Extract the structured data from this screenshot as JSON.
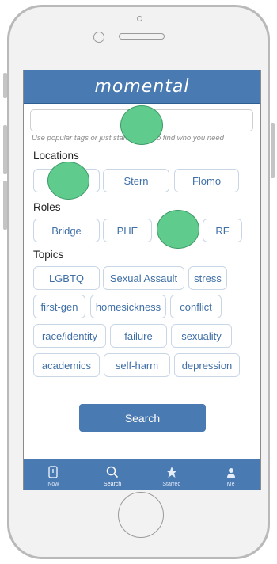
{
  "app": {
    "title": "momental"
  },
  "search": {
    "value": "",
    "hint": "Use popular tags or just start to type to find who you need"
  },
  "locations": {
    "label": "Locations",
    "chips": [
      "Stern",
      "Flomo"
    ]
  },
  "roles": {
    "label": "Roles",
    "chips": [
      "Bridge",
      "PHE",
      "RF"
    ]
  },
  "topics": {
    "label": "Topics",
    "chips": [
      "LGBTQ",
      "Sexual Assault",
      "stress",
      "first-gen",
      "homesickness",
      "conflict",
      "race/identity",
      "failure",
      "sexuality",
      "academics",
      "self-harm",
      "depression"
    ]
  },
  "search_button": {
    "label": "Search"
  },
  "tabs": [
    {
      "label": "Now",
      "icon": "phone-icon"
    },
    {
      "label": "Search",
      "icon": "search-icon"
    },
    {
      "label": "Starred",
      "icon": "star-icon"
    },
    {
      "label": "Me",
      "icon": "person-icon"
    }
  ],
  "colors": {
    "brand": "#4a7ab2",
    "chip_text": "#3f6fa6",
    "marker": "#5fcc8d"
  }
}
